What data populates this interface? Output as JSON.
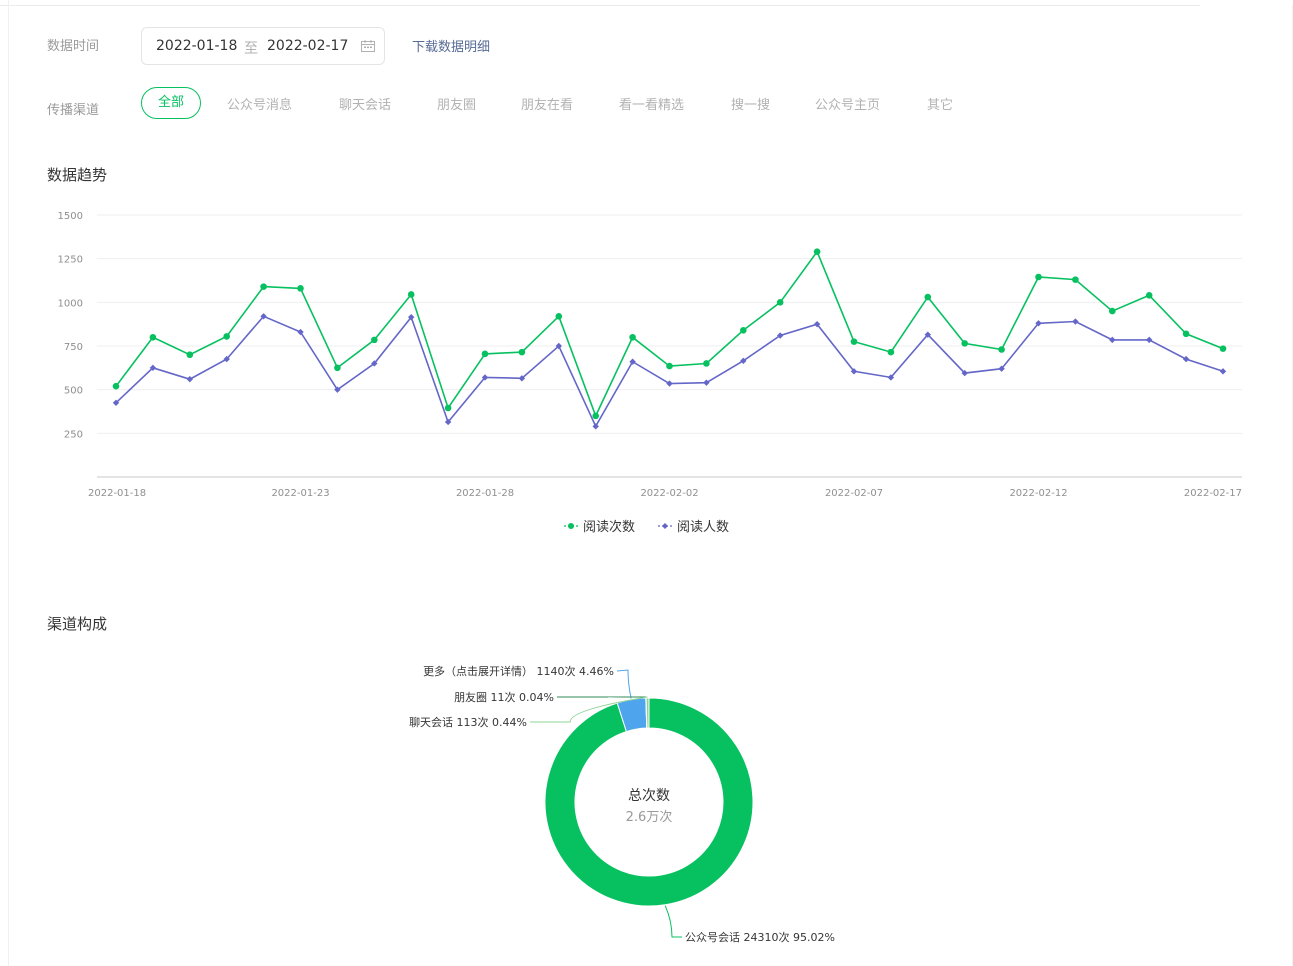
{
  "filters": {
    "date_label": "数据时间",
    "start_date": "2022-01-18",
    "separator": "至",
    "end_date": "2022-02-17",
    "download_link": "下载数据明细",
    "channel_label": "传播渠道",
    "channels": [
      "全部",
      "公众号消息",
      "聊天会话",
      "朋友圈",
      "朋友在看",
      "看一看精选",
      "搜一搜",
      "公众号主页",
      "其它"
    ],
    "active_channel": "全部"
  },
  "trend": {
    "section_title": "数据趋势",
    "chart_data": {
      "type": "line",
      "x": [
        "2022-01-18",
        "2022-01-19",
        "2022-01-20",
        "2022-01-21",
        "2022-01-22",
        "2022-01-23",
        "2022-01-24",
        "2022-01-25",
        "2022-01-26",
        "2022-01-27",
        "2022-01-28",
        "2022-01-29",
        "2022-01-30",
        "2022-01-31",
        "2022-02-01",
        "2022-02-02",
        "2022-02-03",
        "2022-02-04",
        "2022-02-05",
        "2022-02-06",
        "2022-02-07",
        "2022-02-08",
        "2022-02-09",
        "2022-02-10",
        "2022-02-11",
        "2022-02-12",
        "2022-02-13",
        "2022-02-14",
        "2022-02-15",
        "2022-02-16",
        "2022-02-17"
      ],
      "x_tick_labels": [
        "2022-01-18",
        "2022-01-23",
        "2022-01-28",
        "2022-02-02",
        "2022-02-07",
        "2022-02-12",
        "2022-02-17"
      ],
      "y_ticks": [
        250,
        500,
        750,
        1000,
        1250,
        1500
      ],
      "ylim": [
        0,
        1500
      ],
      "grid": true,
      "legend_position": "bottom",
      "series": [
        {
          "name": "阅读次数",
          "color": "#07c160",
          "marker": "circle",
          "values": [
            520,
            800,
            700,
            805,
            1090,
            1080,
            625,
            785,
            1045,
            395,
            705,
            715,
            920,
            350,
            800,
            635,
            650,
            840,
            1000,
            1290,
            775,
            715,
            1030,
            765,
            730,
            1145,
            1130,
            950,
            1040,
            820,
            735
          ]
        },
        {
          "name": "阅读人数",
          "color": "#6467c8",
          "marker": "diamond",
          "values": [
            425,
            625,
            560,
            675,
            920,
            830,
            500,
            650,
            915,
            315,
            570,
            565,
            750,
            290,
            660,
            535,
            540,
            665,
            810,
            875,
            605,
            570,
            815,
            595,
            620,
            880,
            890,
            785,
            785,
            675,
            605
          ]
        }
      ]
    }
  },
  "composition": {
    "section_title": "渠道构成",
    "center_title": "总次数",
    "center_value": "2.6万次",
    "chart_data": {
      "type": "pie",
      "slices": [
        {
          "label": "公众号会话 24310次 95.02%",
          "value": 24310,
          "percent": 95.02,
          "color": "#07c160"
        },
        {
          "label": "更多（点击展开详情） 1140次 4.46%",
          "value": 1140,
          "percent": 4.46,
          "color": "#4ea5ee"
        },
        {
          "label": "朋友圈 11次 0.04%",
          "value": 11,
          "percent": 0.04,
          "color": "#2e8b57"
        },
        {
          "label": "聊天会话 113次 0.44%",
          "value": 113,
          "percent": 0.44,
          "color": "#8fd497"
        }
      ]
    }
  }
}
